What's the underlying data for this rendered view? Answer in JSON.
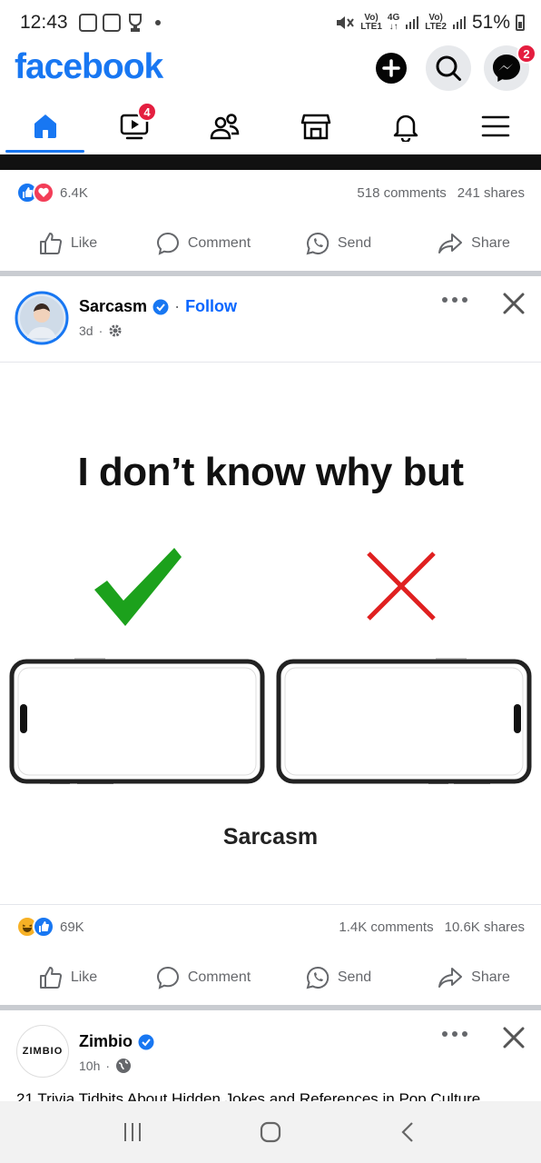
{
  "status_bar": {
    "time": "12:43",
    "net1_top": "Vo)",
    "net1_bottom": "LTE1",
    "net_4g": "4G",
    "net2_top": "Vo)",
    "net2_bottom": "LTE2",
    "battery": "51%"
  },
  "header": {
    "logo": "facebook",
    "messenger_badge": "2"
  },
  "nav": {
    "video_badge": "4"
  },
  "post1": {
    "reactions_count": "6.4K",
    "comments": "518 comments",
    "shares": "241 shares"
  },
  "actions": {
    "like": "Like",
    "comment": "Comment",
    "send": "Send",
    "share": "Share"
  },
  "post2": {
    "author": "Sarcasm",
    "dot": "·",
    "follow": "Follow",
    "time": "3d",
    "meme_title": "I don’t know why but",
    "meme_caption": "Sarcasm",
    "reactions_count": "69K",
    "comments": "1.4K comments",
    "shares": "10.6K shares"
  },
  "post3": {
    "author": "Zimbio",
    "logo_text": "ZIMBIO",
    "time": "10h",
    "text_preview": "21 Trivia Tidbits About Hidden Jokes and References in Pop Culture"
  },
  "colors": {
    "brand": "#1877f2",
    "badge": "#e41e3f",
    "check": "#1ca11c",
    "cross": "#e02020"
  }
}
